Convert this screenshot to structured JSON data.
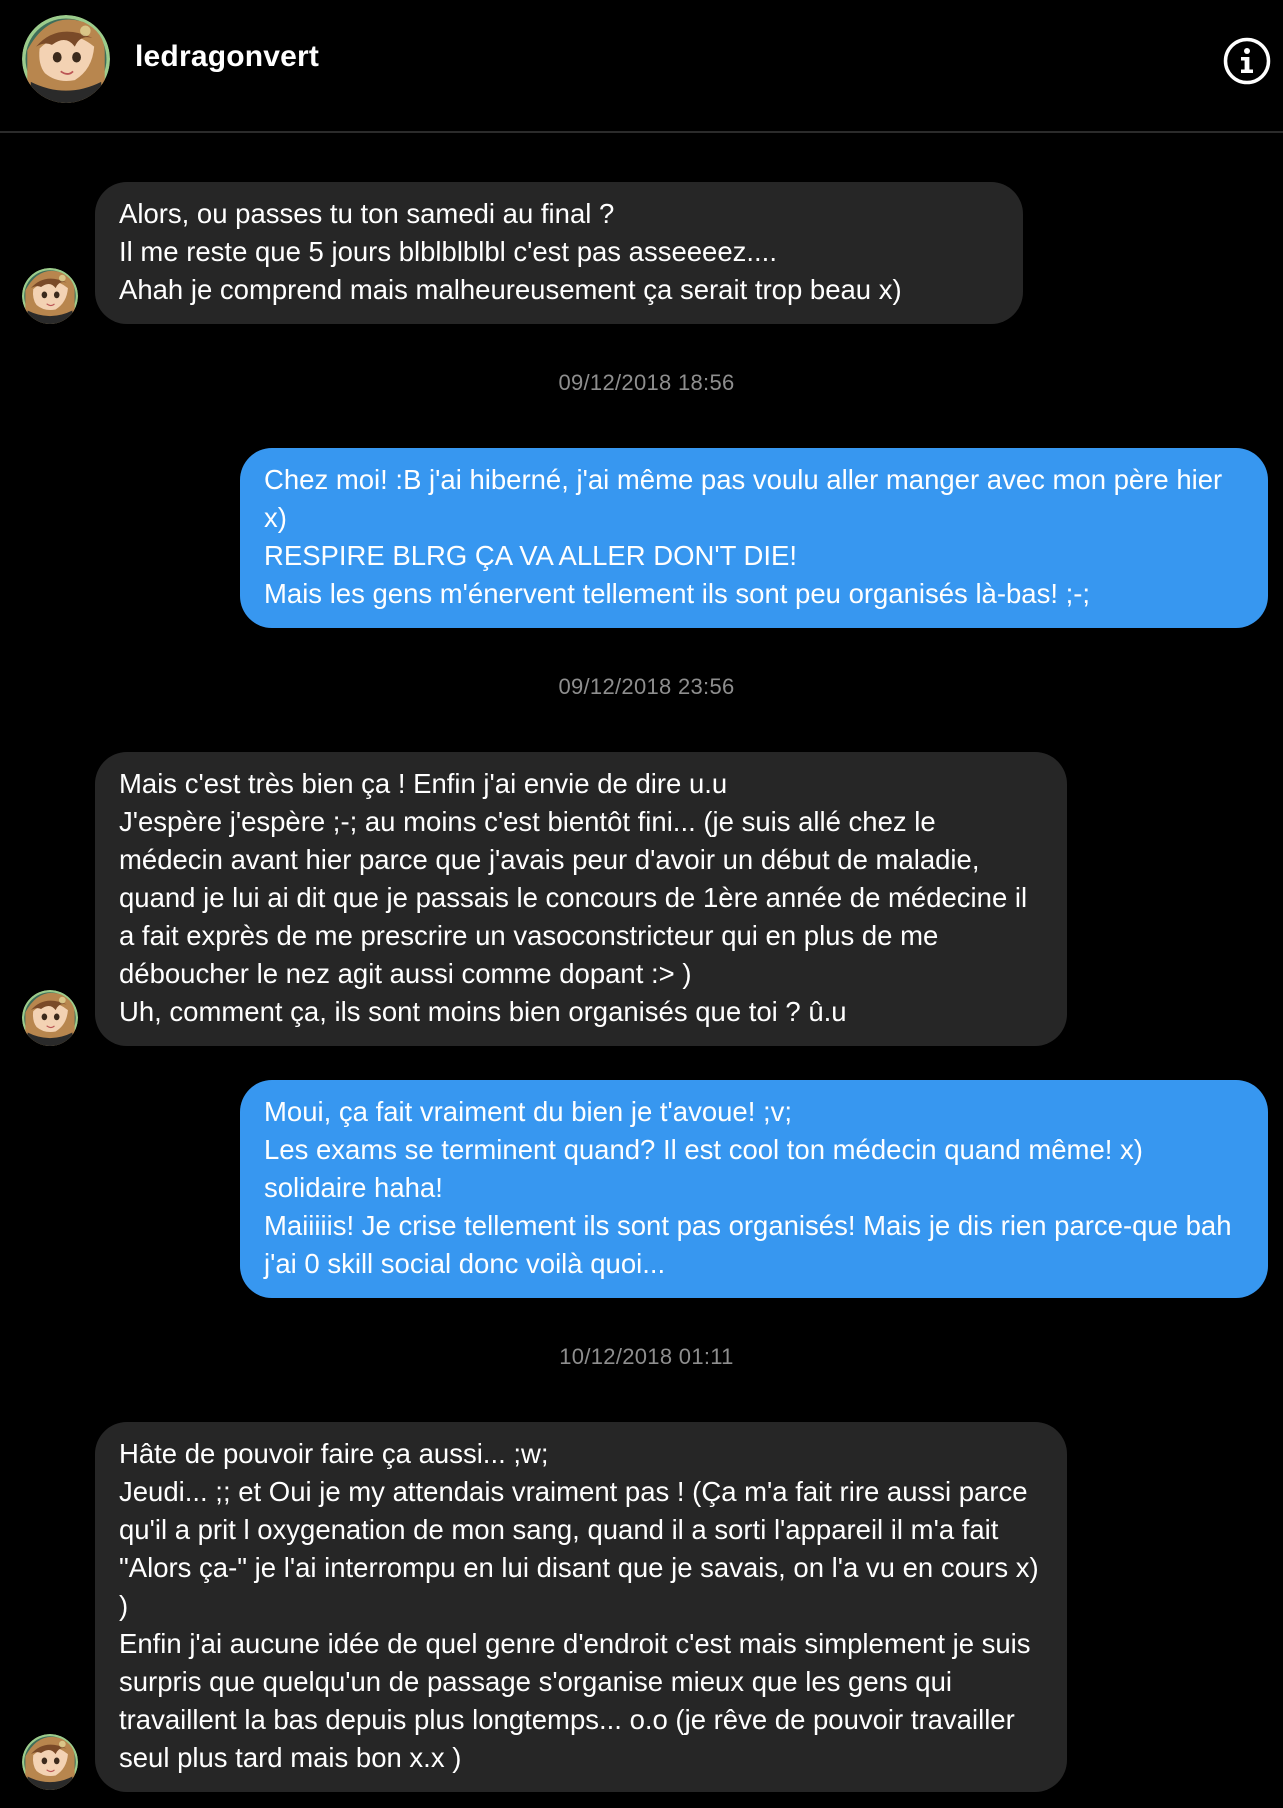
{
  "header": {
    "username": "ledragonvert",
    "avatar_icon": "profile-avatar",
    "info_icon": "info-icon"
  },
  "colors": {
    "background": "#000000",
    "incoming_bubble": "#262626",
    "outgoing_bubble": "#3797f0",
    "timestamp_text": "#8e8e8e"
  },
  "messages": [
    {
      "sender": "ledragonvert",
      "text": "Alors, ou passes tu ton samedi au final ?\nIl me reste que 5 jours blblblblbl c'est pas asseeeez....\n Ahah je comprend mais malheureusement ça serait trop beau x)"
    },
    {
      "timestamp": "09/12/2018 18:56"
    },
    {
      "sender": "me",
      "text": "Chez moi! :B j'ai hiberné, j'ai même pas voulu aller manger avec mon père hier x)\nRESPIRE BLRG ÇA VA ALLER DON'T DIE!\nMais les gens m'énervent tellement ils sont peu organisés là-bas! ;-;"
    },
    {
      "timestamp": "09/12/2018 23:56"
    },
    {
      "sender": "ledragonvert",
      "text": "Mais c'est très bien ça ! Enfin j'ai envie de dire u.u\nJ'espère j'espère ;-; au moins c'est bientôt fini... (je suis allé chez le médecin avant hier parce que j'avais peur d'avoir un début de maladie, quand je lui ai dit que je passais le concours de 1ère année de médecine il a fait exprès de me prescrire un vasoconstricteur qui en plus de me déboucher le nez agit aussi comme dopant :> )\nUh, comment ça, ils sont moins bien organisés que toi ? û.u"
    },
    {
      "sender": "me",
      "text": "Moui, ça fait vraiment du bien je t'avoue! ;v;\nLes exams se terminent quand? Il est cool ton médecin quand même! x) solidaire haha!\nMaiiiiis! Je crise tellement ils sont pas organisés! Mais je dis rien parce-que bah j'ai 0 skill social donc voilà quoi..."
    },
    {
      "timestamp": "10/12/2018 01:11"
    },
    {
      "sender": "ledragonvert",
      "text": "Hâte de pouvoir faire ça aussi... ;w;\nJeudi... ;; et Oui je my attendais vraiment pas ! (Ça m'a fait rire aussi parce qu'il a prit l oxygenation de mon sang, quand il a sorti l'appareil il m'a fait \"Alors ça-\" je l'ai interrompu en lui disant que je savais, on l'a vu en cours x) )\nEnfin j'ai aucune idée de quel genre d'endroit c'est mais simplement je suis surpris que quelqu'un de passage s'organise mieux que les gens qui travaillent la bas depuis plus longtemps... o.o (je rêve de pouvoir travailler seul plus tard mais bon x.x )"
    }
  ]
}
